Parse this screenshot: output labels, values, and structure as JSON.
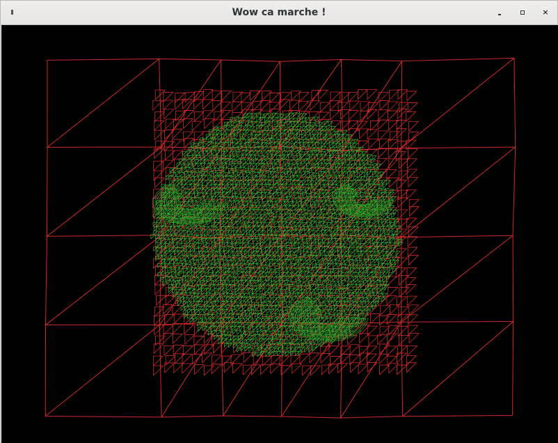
{
  "window": {
    "title": "Wow ca marche !",
    "close_symbol": "×",
    "icons": [
      "window-menu-icon",
      "minimize-icon",
      "maximize-icon",
      "close-icon"
    ]
  },
  "viewport": {
    "background": "#000000",
    "outer_mesh_color": "#d22a2a",
    "inner_mesh_color": "#2bb52b",
    "render_mode": "wireframe"
  }
}
